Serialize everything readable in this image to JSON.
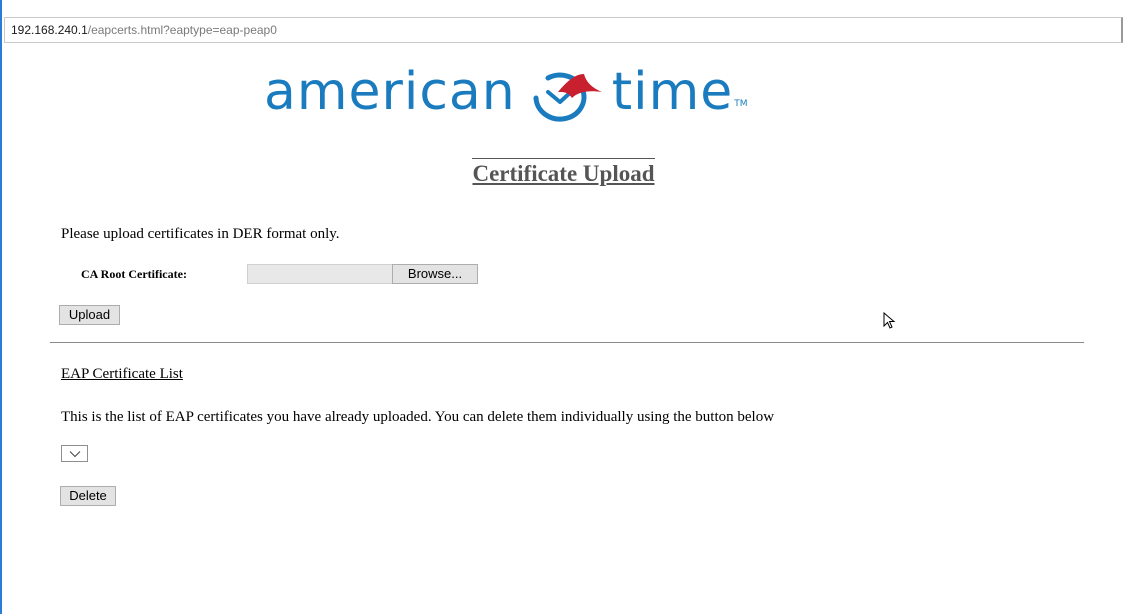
{
  "browser": {
    "url_host": "192.168.240.1",
    "url_path": "/eapcerts.html?eaptype=eap-peap0"
  },
  "logo": {
    "word_left": "american",
    "word_right": "time",
    "trademark": "TM",
    "brand_color": "#1a7bbf",
    "accent_color": "#c8202f"
  },
  "page": {
    "title": "Certificate Upload",
    "instruction": "Please upload certificates in DER format only."
  },
  "upload_form": {
    "ca_root_label": "CA Root Certificate:",
    "file_value": "",
    "browse_label": "Browse...",
    "upload_label": "Upload"
  },
  "cert_list": {
    "heading": "EAP Certificate List",
    "description": "This is the list of EAP certificates you have already uploaded. You can delete them individually using the button below",
    "selected_value": "",
    "delete_label": "Delete"
  }
}
